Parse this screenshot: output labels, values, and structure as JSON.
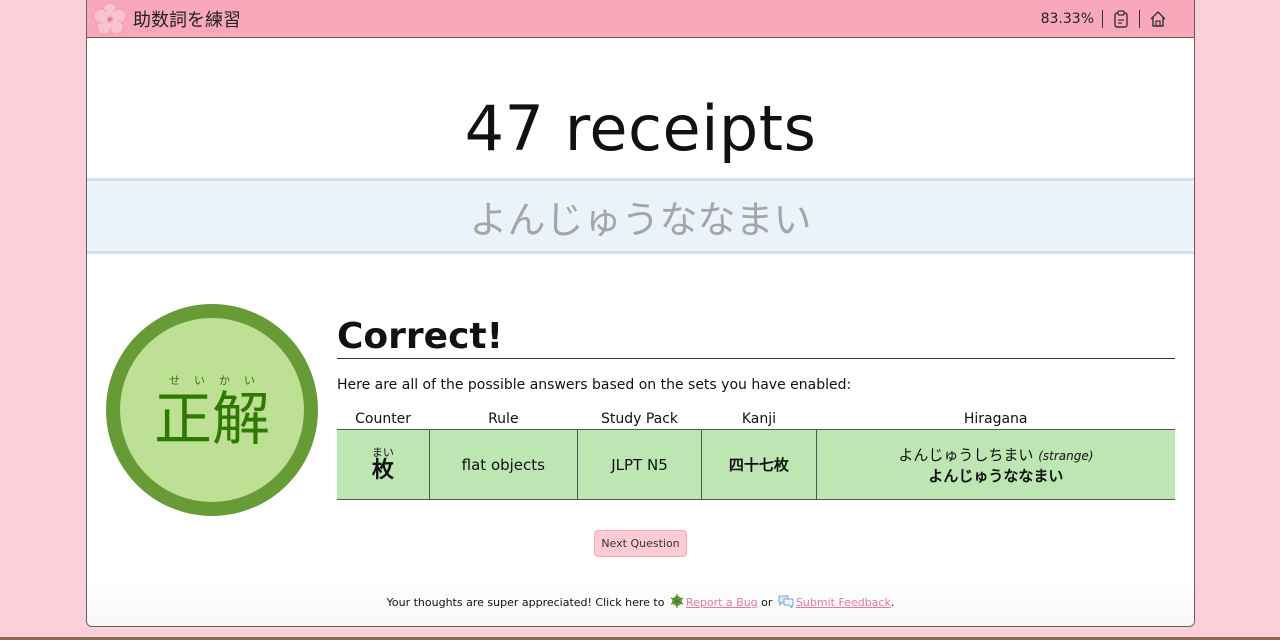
{
  "header": {
    "logo": "sakura-icon",
    "title": "助数詞を練習",
    "progress": "83.33%",
    "icons": [
      "clipboard-icon",
      "home-icon"
    ]
  },
  "question": {
    "prompt": "47 receipts",
    "user_answer": "よんじゅうななまい"
  },
  "result": {
    "badge_ruby": "せいかい",
    "badge_kanji": "正解",
    "title": "Correct!",
    "explanation": "Here are all of the possible answers based on the sets you have enabled:",
    "table": {
      "headers": [
        "Counter",
        "Rule",
        "Study Pack",
        "Kanji",
        "Hiragana"
      ],
      "rows": [
        {
          "counter_ruby": "まい",
          "counter": "枚",
          "rule": "flat objects",
          "study_pack": "JLPT N5",
          "kanji": "四十七枚",
          "hiragana_alt": "よんじゅうしちまい",
          "hiragana_alt_note": "(strange)",
          "hiragana_main": "よんじゅうななまい"
        }
      ]
    },
    "next_button": "Next Question"
  },
  "footer": {
    "text": "Your thoughts are super appreciated! Click here to",
    "bug_link": "Report a Bug",
    "or": "or",
    "feedback_link": "Submit Feedback",
    "end": "."
  },
  "colors": {
    "header_bg": "#f8a8ba",
    "page_bg": "#fbd0d9",
    "badge_ring": "#679b35",
    "badge_fill": "#bde095",
    "row_bg": "#bde6b3",
    "link": "#e87a98"
  }
}
